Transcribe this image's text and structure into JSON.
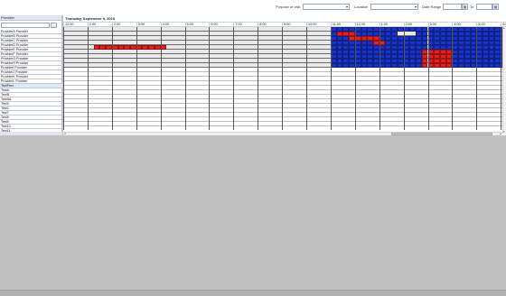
{
  "filters": {
    "purpose_label": "Purpose of visit",
    "purpose_value": "",
    "location_label": "Location",
    "location_value": "",
    "date_range_label": "Date Range",
    "date_from": "",
    "to_label": "To",
    "date_to": ""
  },
  "left_panel": {
    "header": "Provider",
    "search_value": "",
    "search_button": "…",
    "providers": [
      "ProviderA Provider",
      "ProviderB Provider",
      "ProviderC Provider",
      "ProviderD Provider",
      "ProviderE Provider",
      "ProviderF Provider",
      "ProviderG Provider",
      "ProviderH Provider",
      "ProviderI Provider",
      "ProviderJ Provider",
      "ProviderK Provider",
      "ProviderL Provider",
      "TestProv",
      "TestA",
      "TestB",
      "TestAA",
      "Test5",
      "TestC",
      "Test7",
      "Test8",
      "Test9",
      "Test10",
      "Test11"
    ],
    "selected_index": 12
  },
  "schedule": {
    "date_title": "Thursday, September 9, 2010",
    "hours": [
      "12:00",
      "1:00",
      "2:00",
      "3:00",
      "4:00",
      "5:00",
      "6:00",
      "7:00",
      "8:00",
      "9:00",
      "10:00",
      "11:00",
      "12:00",
      "1:00",
      "2:00",
      "3:00",
      "4:00",
      "5:00",
      "6:00"
    ],
    "colors": {
      "booked": "#1a33cc",
      "blocked": "#e8201c",
      "free": "#e9e9e9",
      "gridline": "#555555"
    },
    "slots_per_hour": 4,
    "rows": [
      {
        "red": [],
        "blue": [
          [
            44,
            76
          ]
        ]
      },
      {
        "red": [
          [
            45,
            48
          ]
        ],
        "blue": [
          [
            44,
            45
          ],
          [
            48,
            55
          ],
          [
            58,
            76
          ]
        ]
      },
      {
        "red": [
          [
            47,
            52
          ]
        ],
        "blue": [
          [
            44,
            47
          ],
          [
            52,
            55
          ],
          [
            55,
            58
          ],
          [
            58,
            76
          ]
        ]
      },
      {
        "red": [
          [
            51,
            53
          ]
        ],
        "blue": [
          [
            44,
            51
          ],
          [
            53,
            55
          ],
          [
            55,
            60
          ],
          [
            60,
            76
          ]
        ]
      },
      {
        "red": [
          [
            5,
            17
          ]
        ],
        "blue": [
          [
            44,
            48
          ],
          [
            48,
            52
          ],
          [
            52,
            76
          ]
        ]
      },
      {
        "red": [
          [
            59,
            64
          ]
        ],
        "blue": [
          [
            44,
            59
          ],
          [
            64,
            76
          ]
        ]
      },
      {
        "red": [
          [
            59,
            64
          ]
        ],
        "blue": [
          [
            44,
            59
          ],
          [
            64,
            76
          ]
        ]
      },
      {
        "red": [
          [
            59,
            64
          ]
        ],
        "blue": [
          [
            44,
            59
          ],
          [
            64,
            76
          ]
        ]
      },
      {
        "red": [
          [
            59,
            64
          ]
        ],
        "blue": [
          [
            44,
            59
          ],
          [
            64,
            76
          ]
        ]
      },
      {
        "red": [],
        "blue": []
      },
      {
        "red": [],
        "blue": []
      },
      {
        "red": [],
        "blue": []
      },
      {
        "red": [],
        "blue": []
      },
      {
        "red": [],
        "blue": []
      },
      {
        "red": [],
        "blue": []
      },
      {
        "red": [],
        "blue": []
      },
      {
        "red": [],
        "blue": []
      },
      {
        "red": [],
        "blue": []
      },
      {
        "red": [],
        "blue": []
      },
      {
        "red": [],
        "blue": []
      },
      {
        "red": [],
        "blue": []
      },
      {
        "red": [],
        "blue": []
      },
      {
        "red": [],
        "blue": []
      }
    ]
  }
}
